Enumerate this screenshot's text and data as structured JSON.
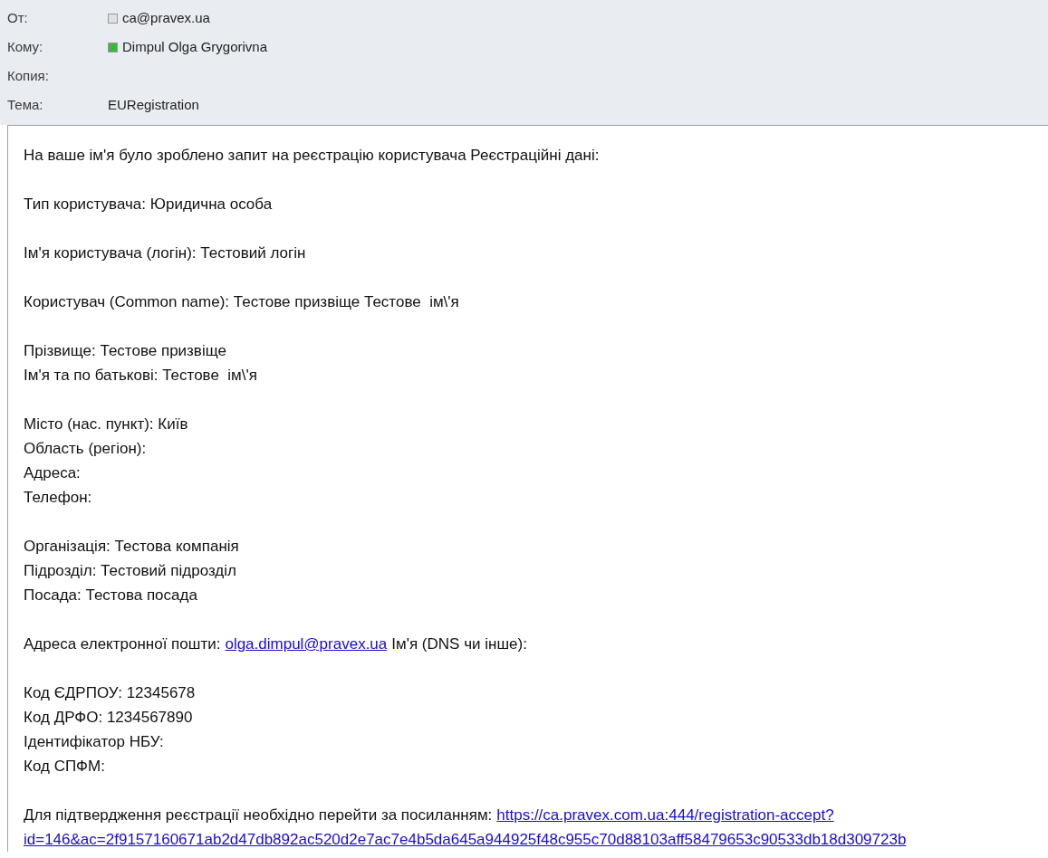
{
  "header": {
    "from": {
      "label": "От:",
      "name": "ca@pravex.ua",
      "color": "#e0e0e0"
    },
    "to": {
      "label": "Кому:",
      "name": "Dimpul Olga Grygorivna",
      "color": "#3cb83c"
    },
    "cc": {
      "label": "Копия:"
    },
    "subject": {
      "label": "Тема:",
      "value": "EURegistration"
    }
  },
  "body": {
    "paragraphs": [
      [
        [
          {
            "kind": "text",
            "text": "На ваше ім'я було зроблено запит на реєстрацію користувача Реєстраційні дані:"
          }
        ]
      ],
      [
        [
          {
            "kind": "text",
            "text": "Тип користувача: Юридична особа"
          }
        ]
      ],
      [
        [
          {
            "kind": "text",
            "text": "Ім'я користувача (логін): Тестовий логін"
          }
        ]
      ],
      [
        [
          {
            "kind": "text",
            "text": "Користувач (Common name): Тестове призвіще Тестове  ім\\'я"
          }
        ]
      ],
      [
        [
          {
            "kind": "text",
            "text": "Прізвище: Тестове призвіще"
          }
        ],
        [
          {
            "kind": "text",
            "text": "Ім'я та по батькові: Тестове  ім\\'я"
          }
        ]
      ],
      [
        [
          {
            "kind": "text",
            "text": "Місто (нас. пункт): Київ"
          }
        ],
        [
          {
            "kind": "text",
            "text": "Область (регіон):"
          }
        ],
        [
          {
            "kind": "text",
            "text": "Адреса:"
          }
        ],
        [
          {
            "kind": "text",
            "text": "Телефон:"
          }
        ]
      ],
      [
        [
          {
            "kind": "text",
            "text": "Організація: Тестова компанія"
          }
        ],
        [
          {
            "kind": "text",
            "text": "Підрозділ: Тестовий підрозділ"
          }
        ],
        [
          {
            "kind": "text",
            "text": "Посада: Тестова посада"
          }
        ]
      ],
      [
        [
          {
            "kind": "text",
            "text": "Адреса електронної пошти:"
          },
          {
            "kind": "link",
            "text": "olga.dimpul@pravex.ua"
          },
          {
            "kind": "text",
            "text": "Ім'я (DNS чи інше):"
          }
        ]
      ],
      [
        [
          {
            "kind": "text",
            "text": "Код ЄДРПОУ: 12345678"
          }
        ],
        [
          {
            "kind": "text",
            "text": "Код ДРФО: 1234567890"
          }
        ],
        [
          {
            "kind": "text",
            "text": "Ідентифікатор НБУ:"
          }
        ],
        [
          {
            "kind": "text",
            "text": "Код СПФМ:"
          }
        ]
      ],
      [
        [
          {
            "kind": "text",
            "text": "Для підтвердження реєстрації необхідно перейти за посиланням:"
          },
          {
            "kind": "link",
            "text": "https://ca.pravex.com.ua:444/registration-accept?"
          }
        ],
        [
          {
            "kind": "link",
            "text": "id=146&ac=2f9157160671ab2d47db892ac520d2e7ac7e4b5da645a944925f48c955c70d88103aff58479653c90533db18d309723b"
          }
        ]
      ]
    ]
  }
}
